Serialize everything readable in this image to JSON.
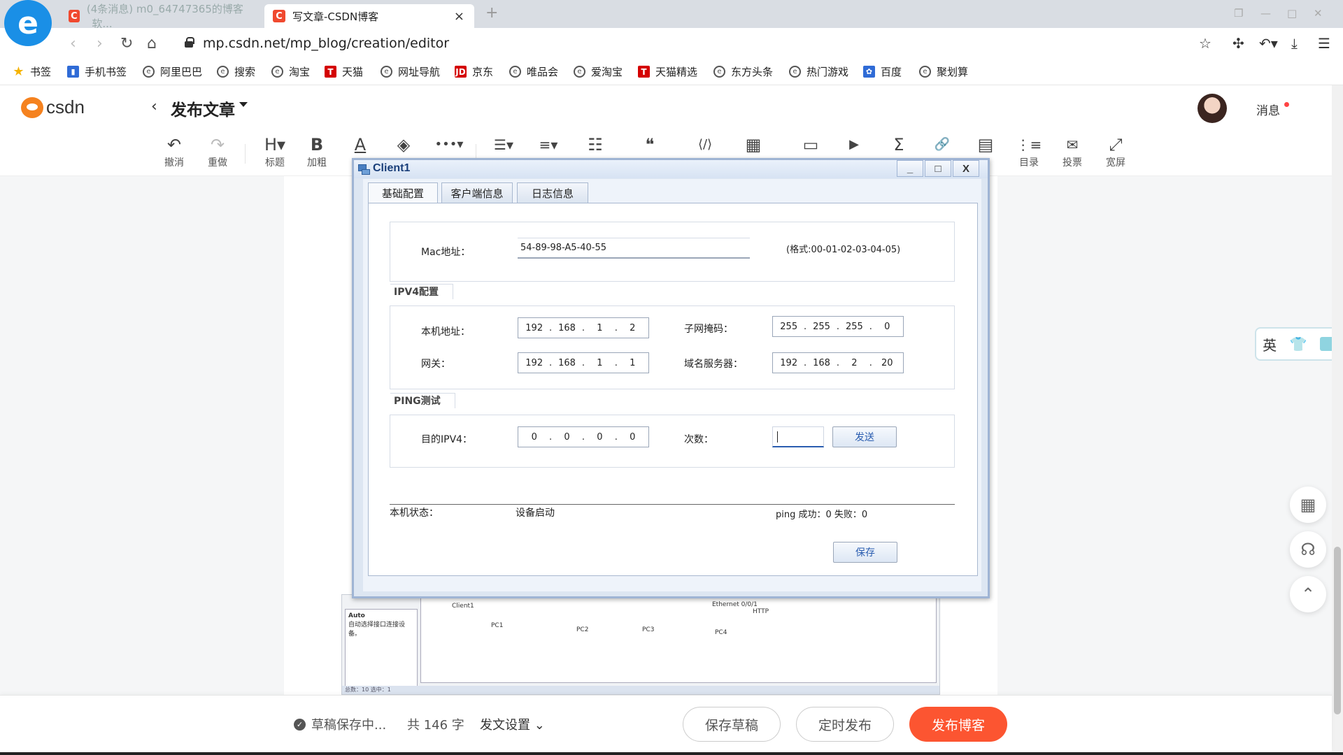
{
  "browser": {
    "logo_glyph": "e",
    "tabs": [
      {
        "label": "(4条消息) m0_64747365的博客_软...",
        "favicon": "C"
      },
      {
        "label": "写文章-CSDN博客",
        "favicon": "C"
      }
    ],
    "tab_close": "×",
    "new_tab": "+",
    "url": "mp.csdn.net/mp_blog/creation/editor",
    "bookmarks": [
      {
        "label": "书签",
        "icon": "star-icon",
        "glyph": "★"
      },
      {
        "label": "手机书签",
        "icon": "phone-icon",
        "glyph": "▮"
      },
      {
        "label": "阿里巴巴",
        "icon": "e-icon",
        "glyph": "e"
      },
      {
        "label": "搜索",
        "icon": "e-icon",
        "glyph": "e"
      },
      {
        "label": "淘宝",
        "icon": "e-icon",
        "glyph": "e"
      },
      {
        "label": "天猫",
        "icon": "tmall-icon",
        "glyph": "T"
      },
      {
        "label": "网址导航",
        "icon": "e-icon",
        "glyph": "e"
      },
      {
        "label": "京东",
        "icon": "jd-icon",
        "glyph": "JD"
      },
      {
        "label": "唯品会",
        "icon": "e-icon",
        "glyph": "e"
      },
      {
        "label": "爱淘宝",
        "icon": "e-icon",
        "glyph": "e"
      },
      {
        "label": "天猫精选",
        "icon": "tmall-icon",
        "glyph": "T"
      },
      {
        "label": "东方头条",
        "icon": "e-icon",
        "glyph": "e"
      },
      {
        "label": "热门游戏",
        "icon": "e-icon",
        "glyph": "e"
      },
      {
        "label": "百度",
        "icon": "baidu-icon",
        "glyph": "✿"
      },
      {
        "label": "聚划算",
        "icon": "e-icon",
        "glyph": "e"
      }
    ]
  },
  "csdn": {
    "logo_text": "csdn",
    "page_title": "发布文章",
    "messages": "消息"
  },
  "toolbar": [
    {
      "glyph": "↶",
      "label": "撤消",
      "icon": "undo-icon"
    },
    {
      "glyph": "↷",
      "label": "重做",
      "icon": "redo-icon"
    },
    {
      "glyph": "H▾",
      "label": "标题",
      "icon": "heading-icon"
    },
    {
      "glyph": "B",
      "label": "加粗",
      "icon": "bold-icon"
    },
    {
      "glyph": "A",
      "label": "",
      "icon": "font-color-icon"
    },
    {
      "glyph": "◈",
      "label": "",
      "icon": "highlight-icon"
    },
    {
      "glyph": "•••▾",
      "label": "",
      "icon": "more-icon"
    },
    {
      "glyph": "☰▾",
      "label": "",
      "icon": "list-icon"
    },
    {
      "glyph": "≡▾",
      "label": "",
      "icon": "align-icon"
    },
    {
      "glyph": "☷",
      "label": "",
      "icon": "indent-icon"
    },
    {
      "glyph": "❝",
      "label": "",
      "icon": "quote-icon"
    },
    {
      "glyph": "⟨/⟩",
      "label": "",
      "icon": "code-icon"
    },
    {
      "glyph": "▦",
      "label": "",
      "icon": "table-icon"
    },
    {
      "glyph": "▭",
      "label": "",
      "icon": "image-icon"
    },
    {
      "glyph": "▶",
      "label": "",
      "icon": "video-icon"
    },
    {
      "glyph": "Σ",
      "label": "",
      "icon": "formula-icon"
    },
    {
      "glyph": "🔗",
      "label": "",
      "icon": "link-icon"
    },
    {
      "glyph": "▤",
      "label": "",
      "icon": "template-icon"
    },
    {
      "glyph": "⋮≡",
      "label": "目录",
      "icon": "toc-icon"
    },
    {
      "glyph": "✉",
      "label": "投票",
      "icon": "vote-icon"
    },
    {
      "glyph": "⤢",
      "label": "宽屏",
      "icon": "widescreen-icon"
    }
  ],
  "dialog": {
    "title": "Client1",
    "min": "_",
    "max": "□",
    "close": "X",
    "tabs": [
      "基础配置",
      "客户端信息",
      "日志信息"
    ],
    "mac_label": "Mac地址：",
    "mac_value": "54-89-98-A5-40-55",
    "mac_format": "(格式:00-01-02-03-04-05)",
    "ipv4_title": "IPV4配置",
    "local_ip_label": "本机地址：",
    "local_ip": [
      "192",
      "168",
      "1",
      "2"
    ],
    "subnet_label": "子网掩码：",
    "subnet": [
      "255",
      "255",
      "255",
      "0"
    ],
    "gateway_label": "网关：",
    "gateway": [
      "192",
      "168",
      "1",
      "1"
    ],
    "dns_label": "域名服务器：",
    "dns": [
      "192",
      "168",
      "2",
      "20"
    ],
    "ping_title": "PING测试",
    "dest_label": "目的IPV4：",
    "dest_ip": [
      "0",
      "0",
      "0",
      "0"
    ],
    "count_label": "次数：",
    "count_value": "",
    "send_button": "发送",
    "status_label": "本机状态：",
    "status_value": "设备启动",
    "ping_result": "ping 成功：0 失败：0",
    "save_button": "保存"
  },
  "background_image": {
    "left_pane_title": "Auto",
    "left_pane_text": "自动选择接口连接设备。",
    "labels": [
      "Client1",
      "PC1",
      "PC2",
      "PC3",
      "PC4",
      "Ethernet 0/0/1",
      "HTTP"
    ],
    "status_strip": "总数：10 选中：1"
  },
  "ime": {
    "lang": "英"
  },
  "bottom": {
    "draft_status": "草稿保存中...",
    "word_count": "共 146 字",
    "publish_settings": "发文设置",
    "save_draft": "保存草稿",
    "schedule": "定时发布",
    "publish": "发布博客"
  },
  "colors": {
    "accent": "#fc5531",
    "dialog_title": "#1a3f7a",
    "link_blue": "#2a5db0"
  }
}
